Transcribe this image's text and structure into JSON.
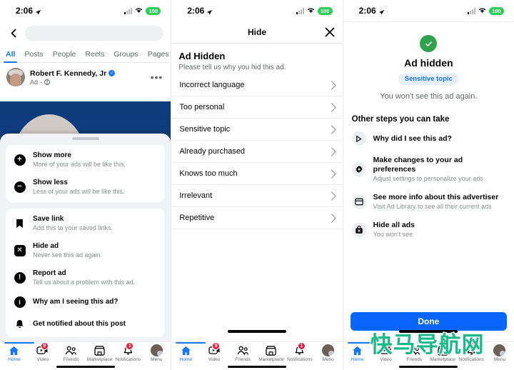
{
  "status_bar": {
    "time": "2:06",
    "battery": "100",
    "location_icon": "location-arrow-icon",
    "wifi_icon": "wifi-icon",
    "signal_icon": "cellular-signal-icon"
  },
  "panel1": {
    "search": {
      "placeholder": "",
      "value": "",
      "back_icon": "back-chevron-icon"
    },
    "tabs": [
      {
        "label": "All",
        "active": true
      },
      {
        "label": "Posts",
        "active": false
      },
      {
        "label": "People",
        "active": false
      },
      {
        "label": "Reels",
        "active": false
      },
      {
        "label": "Groups",
        "active": false
      },
      {
        "label": "Pages",
        "active": false
      }
    ],
    "post": {
      "author": "Robert F. Kennedy, Jr",
      "verified": true,
      "meta": "Ad",
      "separator": "·",
      "privacy_icon": "globe-icon",
      "more_icon": "more-options-icon"
    },
    "sheet": {
      "group1": [
        {
          "icon": "plus-circle-icon",
          "title": "Show more",
          "desc": "More of your ads will be like this."
        },
        {
          "icon": "minus-circle-icon",
          "title": "Show less",
          "desc": "Less of your ads will be like this."
        }
      ],
      "group2": [
        {
          "icon": "bookmark-icon",
          "title": "Save link",
          "desc": "Add this to your saved links."
        },
        {
          "icon": "close-square-icon",
          "title": "Hide ad",
          "desc": "Never see this ad again."
        },
        {
          "icon": "exclamation-circle-icon",
          "title": "Report ad",
          "desc": "Tell us about a problem with this ad."
        },
        {
          "icon": "info-circle-icon",
          "title": "Why am I seeing this ad?",
          "desc": ""
        },
        {
          "icon": "bell-icon",
          "title": "Get notified about this post",
          "desc": ""
        }
      ]
    }
  },
  "panel2": {
    "header": {
      "title": "Hide",
      "close_icon": "close-icon"
    },
    "heading": "Ad Hidden",
    "subheading": "Please tell us why you hid this ad.",
    "reasons": [
      "Incorrect language",
      "Too personal",
      "Sensitive topic",
      "Already purchased",
      "Knows too much",
      "Irrelevant",
      "Repetitive"
    ]
  },
  "panel3": {
    "check_icon": "check-circle-icon",
    "title": "Ad hidden",
    "badge": "Sensitive topic",
    "subtitle": "You won't see this ad again.",
    "other_title": "Other steps you can take",
    "steps": [
      {
        "icon": "play-outline-icon",
        "title": "Why did I see this ad?",
        "desc": ""
      },
      {
        "icon": "gear-icon",
        "title": "Make changes to your ad preferences",
        "desc": "Adjust settings to personalize your ads"
      },
      {
        "icon": "window-icon",
        "title": "See more info about this advertiser",
        "desc": "Visit Ad Library to see all their current ads"
      },
      {
        "icon": "hide-ads-icon",
        "title": "Hide all ads",
        "desc": "You won't see"
      }
    ],
    "done_label": "Done"
  },
  "bottom_nav": [
    {
      "label": "Home",
      "icon": "home-icon",
      "badge": "",
      "active": true
    },
    {
      "label": "Video",
      "icon": "video-icon",
      "badge": "9",
      "active": false
    },
    {
      "label": "Friends",
      "icon": "friends-icon",
      "badge": "",
      "active": false
    },
    {
      "label": "Marketplace",
      "icon": "marketplace-icon",
      "badge": "",
      "active": false
    },
    {
      "label": "Notifications",
      "icon": "bell-icon",
      "badge": "1",
      "active": false
    },
    {
      "label": "Menu",
      "icon": "avatar-menu-icon",
      "badge": "",
      "active": false
    }
  ],
  "watermark": {
    "text": "快马导航网",
    "color": "#1bb98a"
  },
  "colors": {
    "accent": "#1877f2",
    "done_button": "#0866ff",
    "badge_red": "#e41e3f",
    "success_green": "#31a24c",
    "battery_green": "#2ecc5b"
  }
}
